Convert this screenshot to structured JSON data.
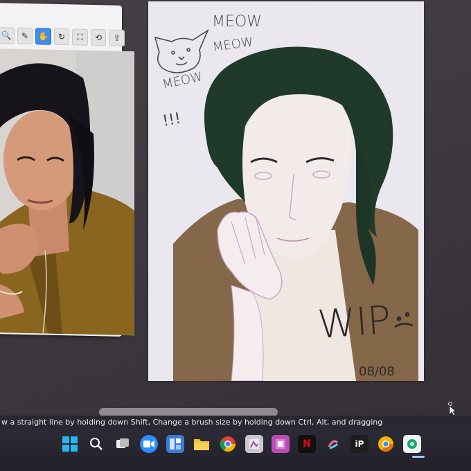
{
  "reference_panel": {
    "tools": [
      {
        "name": "zoom-icon",
        "glyph": "🔍"
      },
      {
        "name": "eyedropper-icon",
        "glyph": "✎"
      },
      {
        "name": "hand-icon",
        "glyph": "✋"
      },
      {
        "name": "rotate-icon",
        "glyph": "↻"
      },
      {
        "name": "fit-icon",
        "glyph": "⛶"
      },
      {
        "name": "reset-icon",
        "glyph": "⟲"
      },
      {
        "name": "import-icon",
        "glyph": "⇪"
      }
    ]
  },
  "canvas": {
    "doodle_text_1": "MEOW",
    "doodle_text_2": "MEOW",
    "doodle_text_3": "MEOW",
    "doodle_exclaim": "!!!",
    "wip_text": "WIP",
    "date_text": "08/08"
  },
  "status_bar": {
    "text": "w a straight line by holding down Shift, Change a brush size by holding down Ctrl, Alt, and dragging"
  },
  "taskbar": {
    "icons": [
      {
        "name": "windows-start-icon",
        "color": "#27a9e8",
        "label": ""
      },
      {
        "name": "search-icon",
        "color": "transparent",
        "label": ""
      },
      {
        "name": "task-view-icon",
        "color": "transparent",
        "label": ""
      },
      {
        "name": "zoom-app-icon",
        "color": "#2d8cff",
        "label": ""
      },
      {
        "name": "widgets-icon",
        "color": "#3a7bd5",
        "label": ""
      },
      {
        "name": "file-explorer-icon",
        "color": "#f1c232",
        "label": ""
      },
      {
        "name": "chrome-icon",
        "color": "#e34133",
        "label": ""
      },
      {
        "name": "app-icon-1",
        "color": "#c9c6cf",
        "label": ""
      },
      {
        "name": "app-icon-2",
        "color": "#b84fb5",
        "label": ""
      },
      {
        "name": "netflix-icon",
        "color": "#111111",
        "label": "N"
      },
      {
        "name": "app-icon-3",
        "color": "#2b2b2b",
        "label": ""
      },
      {
        "name": "ibis-paint-icon",
        "color": "#1d1d1d",
        "label": "iP"
      },
      {
        "name": "chrome-canary-icon",
        "color": "#f4b400",
        "label": ""
      },
      {
        "name": "clip-studio-icon",
        "color": "#f0f0f0",
        "label": ""
      }
    ]
  }
}
